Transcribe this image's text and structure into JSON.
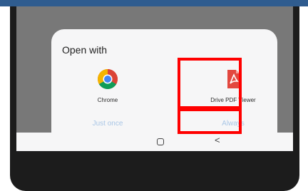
{
  "dialog": {
    "title": "Open with",
    "apps": [
      {
        "label": "Chrome",
        "icon": "chrome-icon"
      },
      {
        "label": "Drive PDF Viewer",
        "icon": "pdf-file-icon"
      }
    ],
    "buttons": {
      "just_once": "Just once",
      "always": "Always"
    }
  },
  "navbar": {
    "home_icon": "home-square-icon",
    "back_icon": "back-chevron-icon",
    "back_glyph": "<"
  },
  "colors": {
    "highlight": "#ff0000",
    "button_text": "#a9c6e6",
    "top_bar": "#2f5c8f",
    "pdf_red": "#e2483f"
  }
}
